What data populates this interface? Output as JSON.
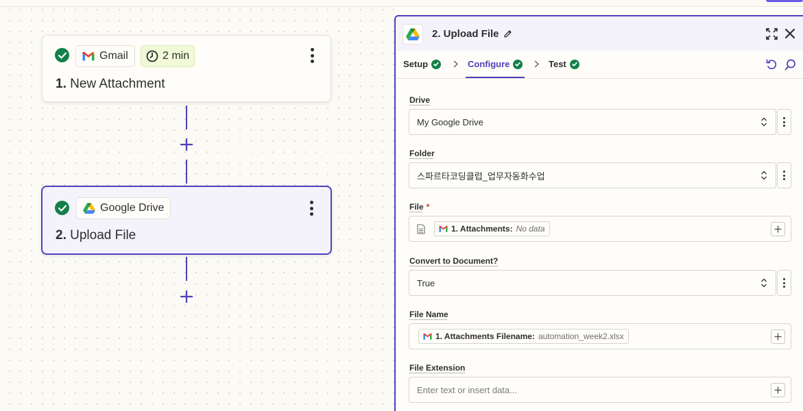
{
  "canvas": {
    "step1": {
      "app_name": "Gmail",
      "time": "2 min",
      "number": "1.",
      "title": "New Attachment"
    },
    "step2": {
      "app_name": "Google Drive",
      "number": "2.",
      "title": "Upload File"
    }
  },
  "panel": {
    "title": "2. Upload File",
    "tabs": [
      {
        "label": "Setup"
      },
      {
        "label": "Configure"
      },
      {
        "label": "Test"
      }
    ],
    "fields": {
      "drive": {
        "label": "Drive",
        "value": "My Google Drive"
      },
      "folder": {
        "label": "Folder",
        "value": "스파르타코딩클럽_업무자동화수업"
      },
      "file": {
        "label": "File",
        "required_mark": "*",
        "pill_label": "1. Attachments:",
        "pill_value": "No data"
      },
      "convert": {
        "label": "Convert to Document?",
        "value": "True"
      },
      "file_name": {
        "label": "File Name",
        "pill_label": "1. Attachments Filename:",
        "pill_value": "automation_week2.xlsx"
      },
      "file_extension": {
        "label": "File Extension",
        "placeholder": "Enter text or insert data..."
      }
    }
  },
  "colors": {
    "accent": "#503ebd",
    "success": "#138049",
    "required": "#d6361f"
  },
  "icons": [
    "check-circle-icon",
    "gmail-icon",
    "clock-icon",
    "google-drive-icon",
    "kebab-icon",
    "plus-icon",
    "pencil-icon",
    "expand-icon",
    "close-icon",
    "undo-icon",
    "search-icon",
    "chevron-right-icon",
    "select-arrows-icon",
    "file-icon"
  ]
}
